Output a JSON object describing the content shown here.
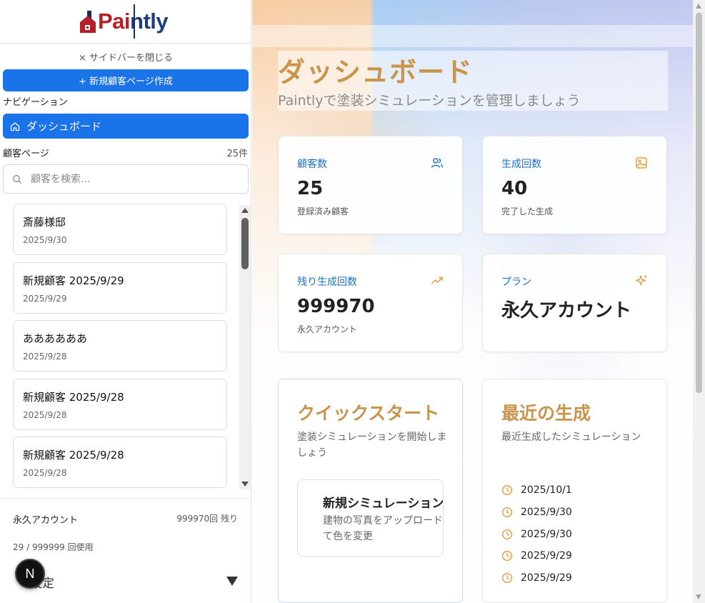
{
  "app": {
    "logo_text_red": "Pai",
    "logo_text_blue": "ntly"
  },
  "colors": {
    "primary": "#1a73e8",
    "accent_gold": "#c8954c",
    "stat_label_blue": "#1d6fc0",
    "logo_red": "#b4202a",
    "logo_blue": "#1c3f7e"
  },
  "sidebar": {
    "close_label": "× サイドバーを閉じる",
    "new_customer_button": "+ 新規顧客ページ作成",
    "nav_heading": "ナビゲーション",
    "nav_dashboard": "ダッシュボード",
    "customers_heading": "顧客ページ",
    "customers_count": "25件",
    "search_placeholder": "顧客を検索...",
    "customers": [
      {
        "name": "斎藤様邸",
        "date": "2025/9/30"
      },
      {
        "name": "新規顧客 2025/9/29",
        "date": "2025/9/29"
      },
      {
        "name": "ああああああ",
        "date": "2025/9/28"
      },
      {
        "name": "新規顧客 2025/9/28",
        "date": "2025/9/28"
      },
      {
        "name": "新規顧客 2025/9/28",
        "date": "2025/9/28"
      }
    ],
    "plan_name": "永久アカウント",
    "plan_remaining": "999970回 残り",
    "plan_usage": "29 / 999999 回使用",
    "settings_label": "設定",
    "n_badge": "N"
  },
  "main": {
    "title": "ダッシュボード",
    "subtitle": "Paintlyで塗装シミュレーションを管理しましょう",
    "stats": {
      "customers": {
        "label": "顧客数",
        "value": "25",
        "sub": "登録済み顧客",
        "icon": "users-icon"
      },
      "generations": {
        "label": "生成回数",
        "value": "40",
        "sub": "完了した生成",
        "icon": "image-icon"
      },
      "remaining": {
        "label": "残り生成回数",
        "value": "999970",
        "sub": "永久アカウント",
        "icon": "trending-up-icon"
      },
      "plan": {
        "label": "プラン",
        "value": "永久アカウント",
        "icon": "sparkles-icon"
      }
    },
    "quick_start": {
      "title": "クイックスタート",
      "desc": "塗装シミュレーションを開始しましょう",
      "new_sim_title": "新規シミュレーション",
      "new_sim_desc": "建物の写真をアップロードして色を変更"
    },
    "recent": {
      "title": "最近の生成",
      "desc": "最近生成したシミュレーション",
      "dates": [
        "2025/10/1",
        "2025/9/30",
        "2025/9/30",
        "2025/9/29",
        "2025/9/29"
      ]
    }
  }
}
